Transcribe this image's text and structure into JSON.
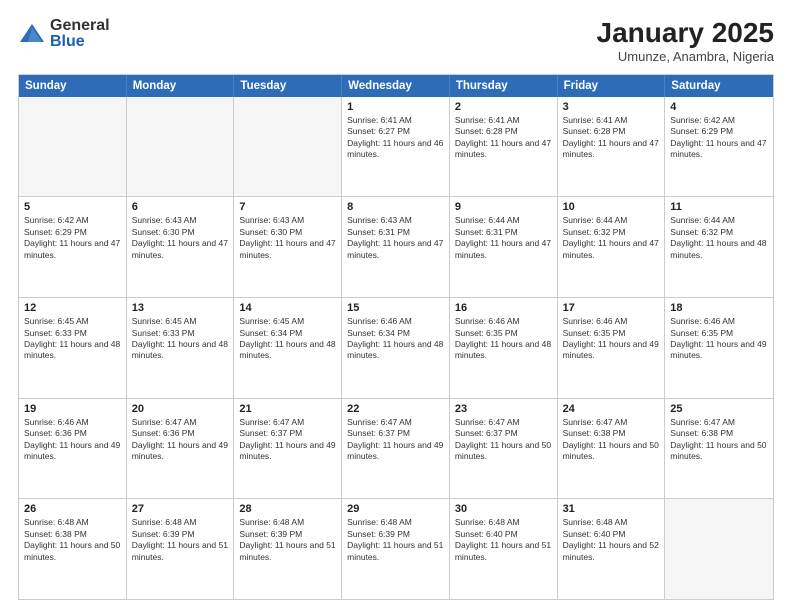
{
  "logo": {
    "general": "General",
    "blue": "Blue"
  },
  "title": "January 2025",
  "subtitle": "Umunze, Anambra, Nigeria",
  "days": [
    "Sunday",
    "Monday",
    "Tuesday",
    "Wednesday",
    "Thursday",
    "Friday",
    "Saturday"
  ],
  "weeks": [
    [
      {
        "day": "",
        "empty": true
      },
      {
        "day": "",
        "empty": true
      },
      {
        "day": "",
        "empty": true
      },
      {
        "day": "1",
        "sunrise": "Sunrise: 6:41 AM",
        "sunset": "Sunset: 6:27 PM",
        "daylight": "Daylight: 11 hours and 46 minutes."
      },
      {
        "day": "2",
        "sunrise": "Sunrise: 6:41 AM",
        "sunset": "Sunset: 6:28 PM",
        "daylight": "Daylight: 11 hours and 47 minutes."
      },
      {
        "day": "3",
        "sunrise": "Sunrise: 6:41 AM",
        "sunset": "Sunset: 6:28 PM",
        "daylight": "Daylight: 11 hours and 47 minutes."
      },
      {
        "day": "4",
        "sunrise": "Sunrise: 6:42 AM",
        "sunset": "Sunset: 6:29 PM",
        "daylight": "Daylight: 11 hours and 47 minutes."
      }
    ],
    [
      {
        "day": "5",
        "sunrise": "Sunrise: 6:42 AM",
        "sunset": "Sunset: 6:29 PM",
        "daylight": "Daylight: 11 hours and 47 minutes."
      },
      {
        "day": "6",
        "sunrise": "Sunrise: 6:43 AM",
        "sunset": "Sunset: 6:30 PM",
        "daylight": "Daylight: 11 hours and 47 minutes."
      },
      {
        "day": "7",
        "sunrise": "Sunrise: 6:43 AM",
        "sunset": "Sunset: 6:30 PM",
        "daylight": "Daylight: 11 hours and 47 minutes."
      },
      {
        "day": "8",
        "sunrise": "Sunrise: 6:43 AM",
        "sunset": "Sunset: 6:31 PM",
        "daylight": "Daylight: 11 hours and 47 minutes."
      },
      {
        "day": "9",
        "sunrise": "Sunrise: 6:44 AM",
        "sunset": "Sunset: 6:31 PM",
        "daylight": "Daylight: 11 hours and 47 minutes."
      },
      {
        "day": "10",
        "sunrise": "Sunrise: 6:44 AM",
        "sunset": "Sunset: 6:32 PM",
        "daylight": "Daylight: 11 hours and 47 minutes."
      },
      {
        "day": "11",
        "sunrise": "Sunrise: 6:44 AM",
        "sunset": "Sunset: 6:32 PM",
        "daylight": "Daylight: 11 hours and 48 minutes."
      }
    ],
    [
      {
        "day": "12",
        "sunrise": "Sunrise: 6:45 AM",
        "sunset": "Sunset: 6:33 PM",
        "daylight": "Daylight: 11 hours and 48 minutes."
      },
      {
        "day": "13",
        "sunrise": "Sunrise: 6:45 AM",
        "sunset": "Sunset: 6:33 PM",
        "daylight": "Daylight: 11 hours and 48 minutes."
      },
      {
        "day": "14",
        "sunrise": "Sunrise: 6:45 AM",
        "sunset": "Sunset: 6:34 PM",
        "daylight": "Daylight: 11 hours and 48 minutes."
      },
      {
        "day": "15",
        "sunrise": "Sunrise: 6:46 AM",
        "sunset": "Sunset: 6:34 PM",
        "daylight": "Daylight: 11 hours and 48 minutes."
      },
      {
        "day": "16",
        "sunrise": "Sunrise: 6:46 AM",
        "sunset": "Sunset: 6:35 PM",
        "daylight": "Daylight: 11 hours and 48 minutes."
      },
      {
        "day": "17",
        "sunrise": "Sunrise: 6:46 AM",
        "sunset": "Sunset: 6:35 PM",
        "daylight": "Daylight: 11 hours and 49 minutes."
      },
      {
        "day": "18",
        "sunrise": "Sunrise: 6:46 AM",
        "sunset": "Sunset: 6:35 PM",
        "daylight": "Daylight: 11 hours and 49 minutes."
      }
    ],
    [
      {
        "day": "19",
        "sunrise": "Sunrise: 6:46 AM",
        "sunset": "Sunset: 6:36 PM",
        "daylight": "Daylight: 11 hours and 49 minutes."
      },
      {
        "day": "20",
        "sunrise": "Sunrise: 6:47 AM",
        "sunset": "Sunset: 6:36 PM",
        "daylight": "Daylight: 11 hours and 49 minutes."
      },
      {
        "day": "21",
        "sunrise": "Sunrise: 6:47 AM",
        "sunset": "Sunset: 6:37 PM",
        "daylight": "Daylight: 11 hours and 49 minutes."
      },
      {
        "day": "22",
        "sunrise": "Sunrise: 6:47 AM",
        "sunset": "Sunset: 6:37 PM",
        "daylight": "Daylight: 11 hours and 49 minutes."
      },
      {
        "day": "23",
        "sunrise": "Sunrise: 6:47 AM",
        "sunset": "Sunset: 6:37 PM",
        "daylight": "Daylight: 11 hours and 50 minutes."
      },
      {
        "day": "24",
        "sunrise": "Sunrise: 6:47 AM",
        "sunset": "Sunset: 6:38 PM",
        "daylight": "Daylight: 11 hours and 50 minutes."
      },
      {
        "day": "25",
        "sunrise": "Sunrise: 6:47 AM",
        "sunset": "Sunset: 6:38 PM",
        "daylight": "Daylight: 11 hours and 50 minutes."
      }
    ],
    [
      {
        "day": "26",
        "sunrise": "Sunrise: 6:48 AM",
        "sunset": "Sunset: 6:38 PM",
        "daylight": "Daylight: 11 hours and 50 minutes."
      },
      {
        "day": "27",
        "sunrise": "Sunrise: 6:48 AM",
        "sunset": "Sunset: 6:39 PM",
        "daylight": "Daylight: 11 hours and 51 minutes."
      },
      {
        "day": "28",
        "sunrise": "Sunrise: 6:48 AM",
        "sunset": "Sunset: 6:39 PM",
        "daylight": "Daylight: 11 hours and 51 minutes."
      },
      {
        "day": "29",
        "sunrise": "Sunrise: 6:48 AM",
        "sunset": "Sunset: 6:39 PM",
        "daylight": "Daylight: 11 hours and 51 minutes."
      },
      {
        "day": "30",
        "sunrise": "Sunrise: 6:48 AM",
        "sunset": "Sunset: 6:40 PM",
        "daylight": "Daylight: 11 hours and 51 minutes."
      },
      {
        "day": "31",
        "sunrise": "Sunrise: 6:48 AM",
        "sunset": "Sunset: 6:40 PM",
        "daylight": "Daylight: 11 hours and 52 minutes."
      },
      {
        "day": "",
        "empty": true
      }
    ]
  ]
}
